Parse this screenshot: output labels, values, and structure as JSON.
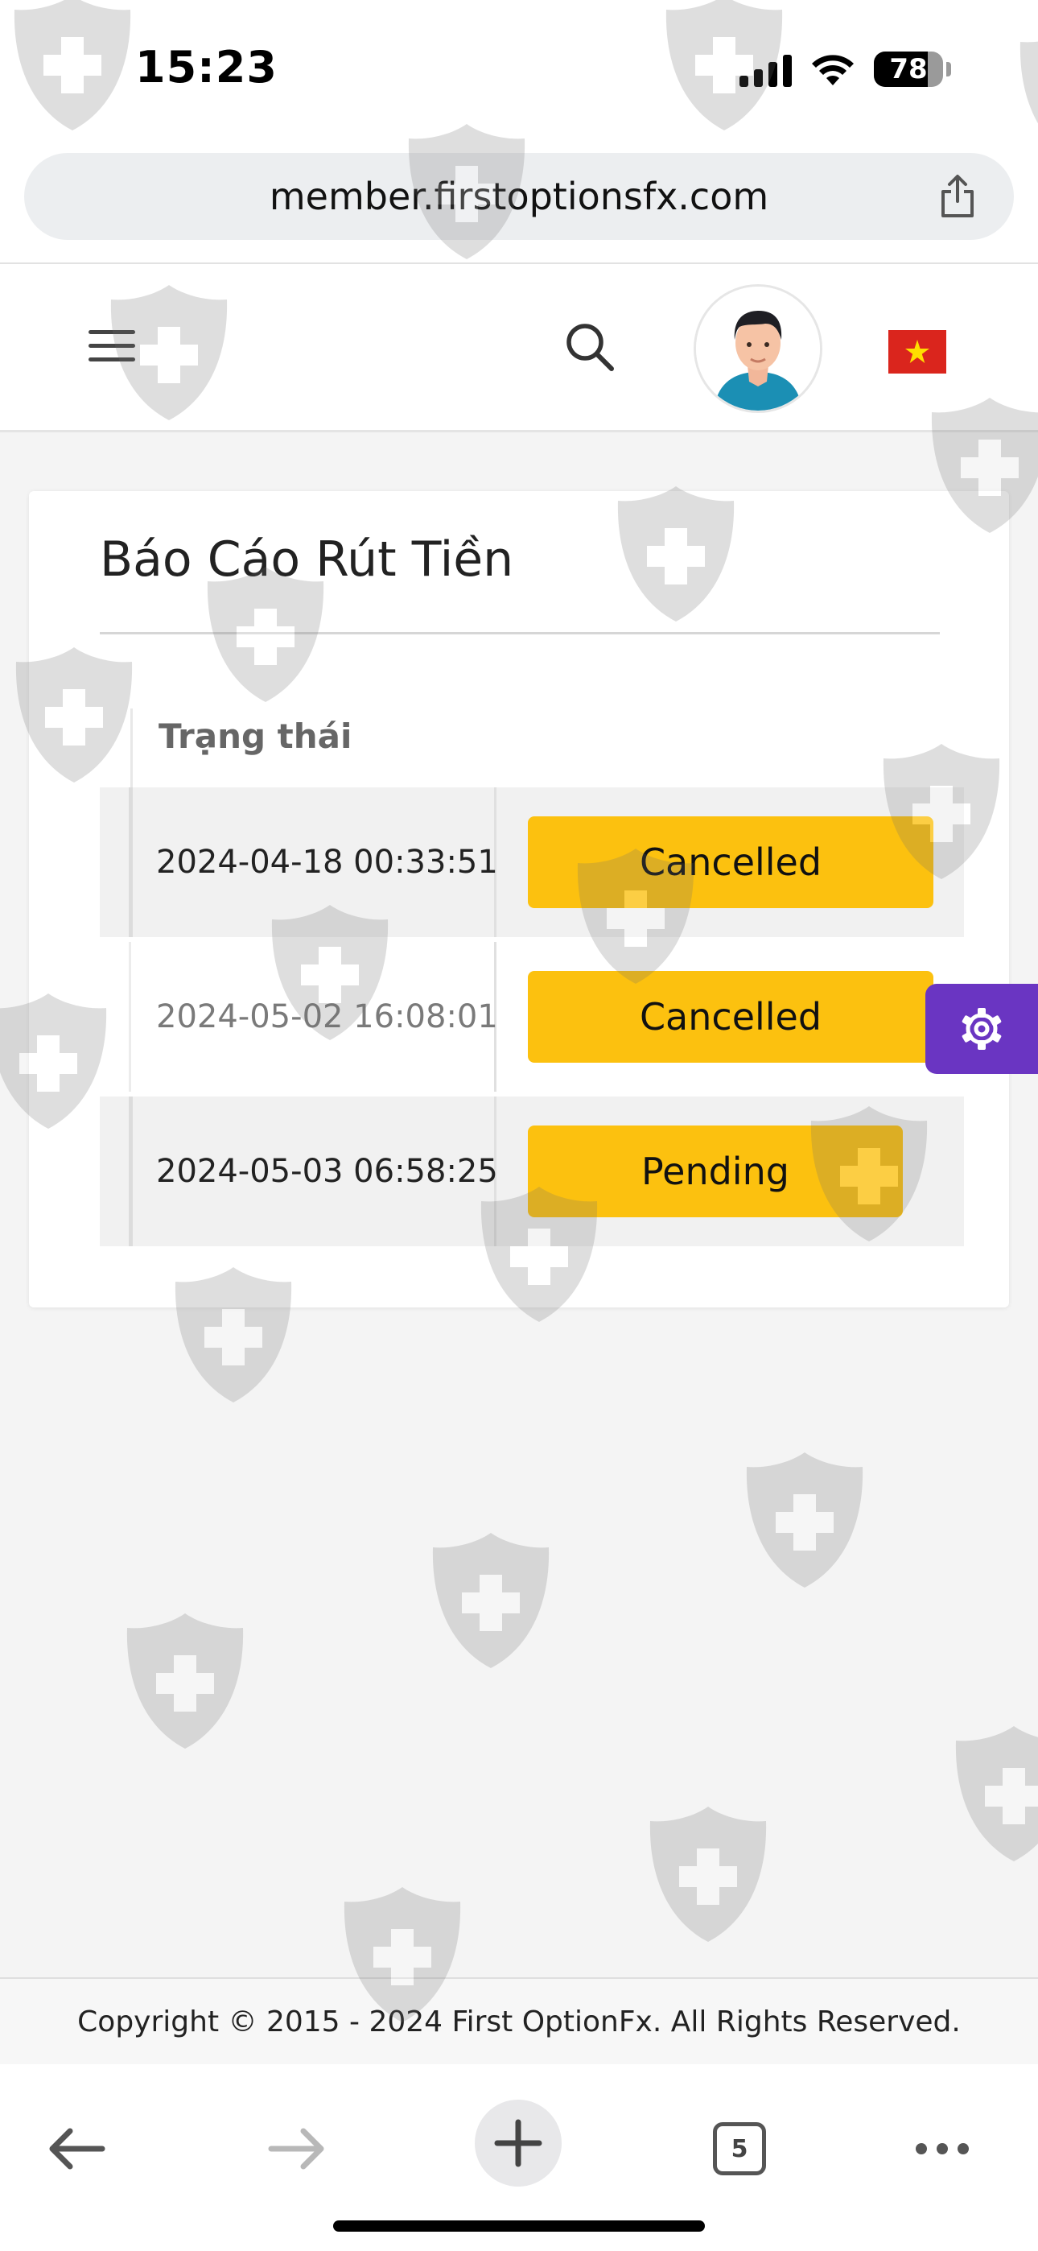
{
  "status_bar": {
    "time": "15:23",
    "battery_level": "78",
    "battery_percent": 78
  },
  "browser": {
    "url": "member.firstoptionsfx.com",
    "open_tabs": "5"
  },
  "header": {
    "avatar_icon": "user-avatar",
    "flag_icon": "vietnam-flag"
  },
  "card": {
    "title": "Báo Cáo Rút Tiền",
    "column_header": "Trạng thái",
    "rows": [
      {
        "date": "2024-04-18 00:33:51",
        "status": "Cancelled"
      },
      {
        "date": "2024-05-02 16:08:01",
        "status": "Cancelled"
      },
      {
        "date": "2024-05-03 06:58:25",
        "status": "Pending"
      }
    ]
  },
  "footer": {
    "copyright": "Copyright © 2015 - 2024 First OptionFx. All Rights Reserved."
  },
  "colors": {
    "status_badge": "#fcc10f",
    "settings_button": "#6a35c2",
    "flag_red": "#da251d",
    "flag_star": "#ffde00"
  }
}
